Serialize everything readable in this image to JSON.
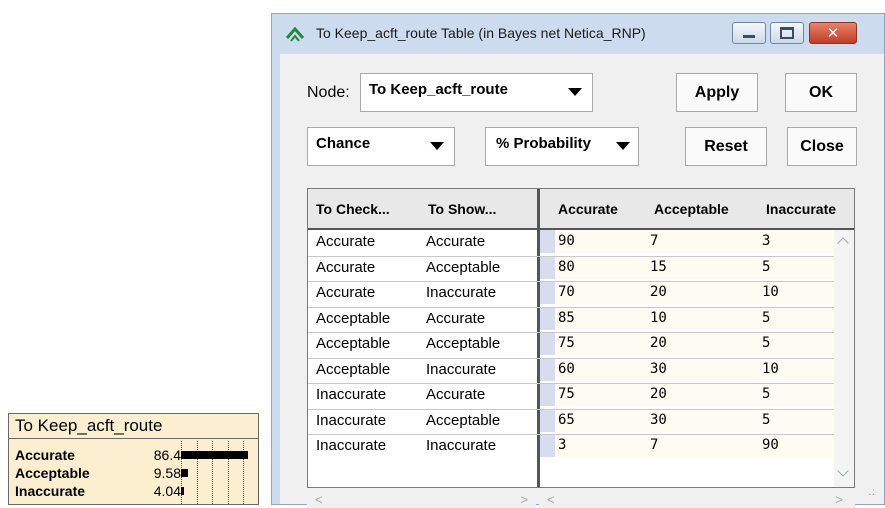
{
  "node": {
    "title": "To Keep_acft_route",
    "states": [
      {
        "label": "Accurate",
        "value": "86.4",
        "fraction": 0.864
      },
      {
        "label": "Acceptable",
        "value": "9.58",
        "fraction": 0.0958
      },
      {
        "label": "Inaccurate",
        "value": "4.04",
        "fraction": 0.0404
      }
    ]
  },
  "window": {
    "title": "To Keep_acft_route   Table (in Bayes net Netica_RNP)",
    "node_label": "Node:",
    "node_value": "To Keep_acft_route",
    "type_value": "Chance",
    "units_value": "% Probability",
    "buttons": {
      "apply": "Apply",
      "ok": "OK",
      "reset": "Reset",
      "close": "Close"
    }
  },
  "table": {
    "parent_headers": [
      "To Check...",
      "To Show..."
    ],
    "state_headers": [
      "Accurate",
      "Acceptable",
      "Inaccurate"
    ],
    "rows": [
      {
        "p1": "Accurate",
        "p2": "Accurate",
        "probs": [
          "90",
          "7",
          "3"
        ]
      },
      {
        "p1": "Accurate",
        "p2": "Acceptable",
        "probs": [
          "80",
          "15",
          "5"
        ]
      },
      {
        "p1": "Accurate",
        "p2": "Inaccurate",
        "probs": [
          "70",
          "20",
          "10"
        ]
      },
      {
        "p1": "Acceptable",
        "p2": "Accurate",
        "probs": [
          "85",
          "10",
          "5"
        ]
      },
      {
        "p1": "Acceptable",
        "p2": "Acceptable",
        "probs": [
          "75",
          "20",
          "5"
        ]
      },
      {
        "p1": "Acceptable",
        "p2": "Inaccurate",
        "probs": [
          "60",
          "30",
          "10"
        ]
      },
      {
        "p1": "Inaccurate",
        "p2": "Accurate",
        "probs": [
          "75",
          "20",
          "5"
        ]
      },
      {
        "p1": "Inaccurate",
        "p2": "Acceptable",
        "probs": [
          "65",
          "30",
          "5"
        ]
      },
      {
        "p1": "Inaccurate",
        "p2": "Inaccurate",
        "probs": [
          "3",
          "7",
          "90"
        ]
      }
    ]
  }
}
